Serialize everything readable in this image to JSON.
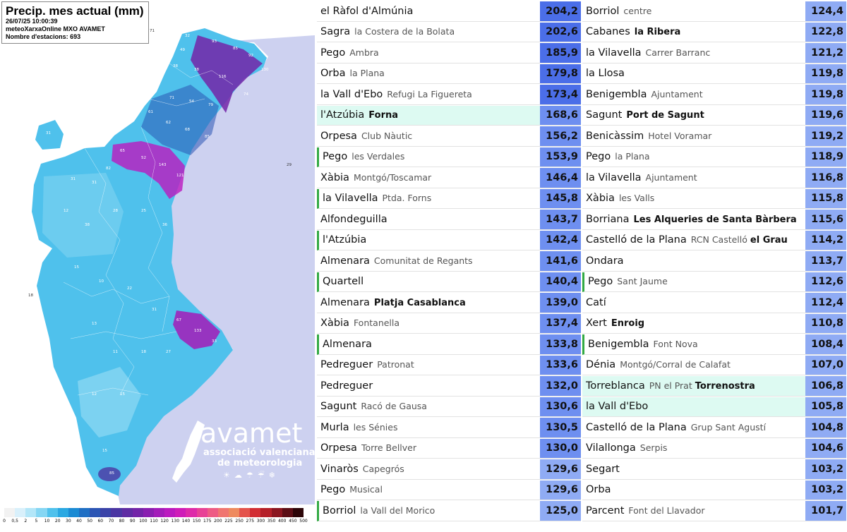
{
  "map": {
    "title": "Precip. mes actual (mm)",
    "datetime": "26/07/25 10:00:39",
    "source": "meteoXarxaOnline MXO AVAMET",
    "stations_count": "Nombre d'estacions: 693",
    "brand": {
      "name": "avamet",
      "line1": "associació valenciana",
      "line2": "de meteorologia"
    },
    "legend": {
      "labels": [
        "0",
        "0,5",
        "2",
        "5",
        "10",
        "20",
        "30",
        "40",
        "50",
        "60",
        "70",
        "80",
        "90",
        "100",
        "110",
        "120",
        "130",
        "140",
        "150",
        "175",
        "200",
        "225",
        "250",
        "275",
        "300",
        "350",
        "400",
        "450",
        "500"
      ],
      "colors": [
        "#f2f2f2",
        "#d9f0fb",
        "#b3e6f8",
        "#85d6f3",
        "#4fc1ec",
        "#2aa8e2",
        "#1b8bd4",
        "#1f6fc4",
        "#2b55b4",
        "#3a43a8",
        "#4b36a3",
        "#5f2ca3",
        "#7324a8",
        "#8a1eb0",
        "#a31bb9",
        "#bb19bf",
        "#cf1cb8",
        "#de2aa9",
        "#e84196",
        "#ee5b84",
        "#f07570",
        "#ee8a5e",
        "#e4534c",
        "#d22e34",
        "#b51f28",
        "#8b1620",
        "#5c0e16",
        "#2c0508"
      ]
    },
    "sea_color": "#cdd1f0",
    "land_color": "#4fc1ec",
    "highlight_color": "#a31bb9"
  },
  "table": {
    "value_colors": {
      "high": "#4b6ee8",
      "mid": "#6e8ff0",
      "low": "#8fabf4"
    },
    "left": [
      {
        "name": "el Ràfol d'Almúnia",
        "sub": "",
        "bold": false,
        "value": "204,2",
        "hl": false,
        "mark": false
      },
      {
        "name": "Sagra",
        "sub": "la Costera de la Bolata",
        "bold": false,
        "value": "202,6",
        "hl": false,
        "mark": false
      },
      {
        "name": "Pego",
        "sub": "Ambra",
        "bold": false,
        "value": "185,9",
        "hl": false,
        "mark": false
      },
      {
        "name": "Orba",
        "sub": "la Plana",
        "bold": false,
        "value": "179,8",
        "hl": false,
        "mark": false
      },
      {
        "name": "la Vall d'Ebo",
        "sub": "Refugi La Figuereta",
        "bold": false,
        "value": "173,4",
        "hl": false,
        "mark": false
      },
      {
        "name": "l'Atzúbia",
        "sub": "Forna",
        "bold": true,
        "value": "168,6",
        "hl": true,
        "mark": false
      },
      {
        "name": "Orpesa",
        "sub": "Club Nàutic",
        "bold": false,
        "value": "156,2",
        "hl": false,
        "mark": false
      },
      {
        "name": "Pego",
        "sub": "les Verdales",
        "bold": false,
        "value": "153,9",
        "hl": false,
        "mark": true
      },
      {
        "name": "Xàbia",
        "sub": "Montgó/Toscamar",
        "bold": false,
        "value": "146,4",
        "hl": false,
        "mark": false
      },
      {
        "name": "la Vilavella",
        "sub": "Ptda. Forns",
        "bold": false,
        "value": "145,8",
        "hl": false,
        "mark": true
      },
      {
        "name": "Alfondeguilla",
        "sub": "",
        "bold": false,
        "value": "143,7",
        "hl": false,
        "mark": false
      },
      {
        "name": "l'Atzúbia",
        "sub": "",
        "bold": false,
        "value": "142,4",
        "hl": false,
        "mark": true
      },
      {
        "name": "Almenara",
        "sub": "Comunitat de Regants",
        "bold": false,
        "value": "141,6",
        "hl": false,
        "mark": false
      },
      {
        "name": "Quartell",
        "sub": "",
        "bold": false,
        "value": "140,4",
        "hl": false,
        "mark": true
      },
      {
        "name": "Almenara",
        "sub": "Platja Casablanca",
        "bold": true,
        "value": "139,0",
        "hl": false,
        "mark": false
      },
      {
        "name": "Xàbia",
        "sub": "Fontanella",
        "bold": false,
        "value": "137,4",
        "hl": false,
        "mark": false
      },
      {
        "name": "Almenara",
        "sub": "",
        "bold": false,
        "value": "133,8",
        "hl": false,
        "mark": true
      },
      {
        "name": "Pedreguer",
        "sub": "Patronat",
        "bold": false,
        "value": "133,6",
        "hl": false,
        "mark": false
      },
      {
        "name": "Pedreguer",
        "sub": "",
        "bold": false,
        "value": "132,0",
        "hl": false,
        "mark": false
      },
      {
        "name": "Sagunt",
        "sub": "Racó de Gausa",
        "bold": false,
        "value": "130,6",
        "hl": false,
        "mark": false
      },
      {
        "name": "Murla",
        "sub": "les Sénies",
        "bold": false,
        "value": "130,5",
        "hl": false,
        "mark": false
      },
      {
        "name": "Orpesa",
        "sub": "Torre Bellver",
        "bold": false,
        "value": "130,0",
        "hl": false,
        "mark": false
      },
      {
        "name": "Vinaròs",
        "sub": "Capegrós",
        "bold": false,
        "value": "129,6",
        "hl": false,
        "mark": false
      },
      {
        "name": "Pego",
        "sub": "Musical",
        "bold": false,
        "value": "129,6",
        "hl": false,
        "mark": false
      },
      {
        "name": "Borriol",
        "sub": "la Vall del Morico",
        "bold": false,
        "value": "125,0",
        "hl": false,
        "mark": true
      }
    ],
    "right": [
      {
        "name": "Borriol",
        "sub": "centre",
        "bold": false,
        "value": "124,4",
        "hl": false,
        "mark": false
      },
      {
        "name": "Cabanes",
        "sub": "la Ribera",
        "bold": true,
        "value": "122,8",
        "hl": false,
        "mark": false
      },
      {
        "name": "la Vilavella",
        "sub": "Carrer Barranc",
        "bold": false,
        "value": "121,2",
        "hl": false,
        "mark": false
      },
      {
        "name": "la Llosa",
        "sub": "",
        "bold": false,
        "value": "119,8",
        "hl": false,
        "mark": false
      },
      {
        "name": "Benigembla",
        "sub": "Ajuntament",
        "bold": false,
        "value": "119,8",
        "hl": false,
        "mark": false
      },
      {
        "name": "Sagunt",
        "sub": "Port de Sagunt",
        "bold": true,
        "value": "119,6",
        "hl": false,
        "mark": false
      },
      {
        "name": "Benicàssim",
        "sub": "Hotel Voramar",
        "bold": false,
        "value": "119,2",
        "hl": false,
        "mark": false
      },
      {
        "name": "Pego",
        "sub": "la Plana",
        "bold": false,
        "value": "118,9",
        "hl": false,
        "mark": false
      },
      {
        "name": "la Vilavella",
        "sub": "Ajuntament",
        "bold": false,
        "value": "116,8",
        "hl": false,
        "mark": false
      },
      {
        "name": "Xàbia",
        "sub": "les Valls",
        "bold": false,
        "value": "115,8",
        "hl": false,
        "mark": false
      },
      {
        "name": "Borriana",
        "sub": "Les Alqueries de Santa Bàrbera",
        "bold": true,
        "value": "115,6",
        "hl": false,
        "mark": false
      },
      {
        "name": "Castelló de la Plana",
        "sub": "RCN Castelló",
        "sub2": "el Grau",
        "bold": false,
        "value": "114,2",
        "hl": false,
        "mark": false
      },
      {
        "name": "Ondara",
        "sub": "",
        "bold": false,
        "value": "113,7",
        "hl": false,
        "mark": false
      },
      {
        "name": "Pego",
        "sub": "Sant Jaume",
        "bold": false,
        "value": "112,6",
        "hl": false,
        "mark": true
      },
      {
        "name": "Catí",
        "sub": "",
        "bold": false,
        "value": "112,4",
        "hl": false,
        "mark": false
      },
      {
        "name": "Xert",
        "sub": "Enroig",
        "bold": true,
        "value": "110,8",
        "hl": false,
        "mark": false
      },
      {
        "name": "Benigembla",
        "sub": "Font Nova",
        "bold": false,
        "value": "108,4",
        "hl": false,
        "mark": true
      },
      {
        "name": "Dénia",
        "sub": "Montgó/Corral de Calafat",
        "bold": false,
        "value": "107,0",
        "hl": false,
        "mark": false
      },
      {
        "name": "Torreblanca",
        "sub": "PN el Prat",
        "sub2": "Torrenostra",
        "bold": false,
        "value": "106,8",
        "hl": true,
        "mark": false
      },
      {
        "name": "la Vall d'Ebo",
        "sub": "",
        "bold": false,
        "value": "105,8",
        "hl": true,
        "mark": false
      },
      {
        "name": "Castelló de la Plana",
        "sub": "Grup Sant Agustí",
        "bold": false,
        "value": "104,8",
        "hl": false,
        "mark": false
      },
      {
        "name": "Vilallonga",
        "sub": "Serpis",
        "bold": false,
        "value": "104,6",
        "hl": false,
        "mark": false
      },
      {
        "name": "Segart",
        "sub": "",
        "bold": false,
        "value": "103,2",
        "hl": false,
        "mark": false
      },
      {
        "name": "Orba",
        "sub": "",
        "bold": false,
        "value": "103,2",
        "hl": false,
        "mark": false
      },
      {
        "name": "Parcent",
        "sub": "Font del Llavador",
        "bold": false,
        "value": "101,7",
        "hl": false,
        "mark": false
      }
    ]
  }
}
